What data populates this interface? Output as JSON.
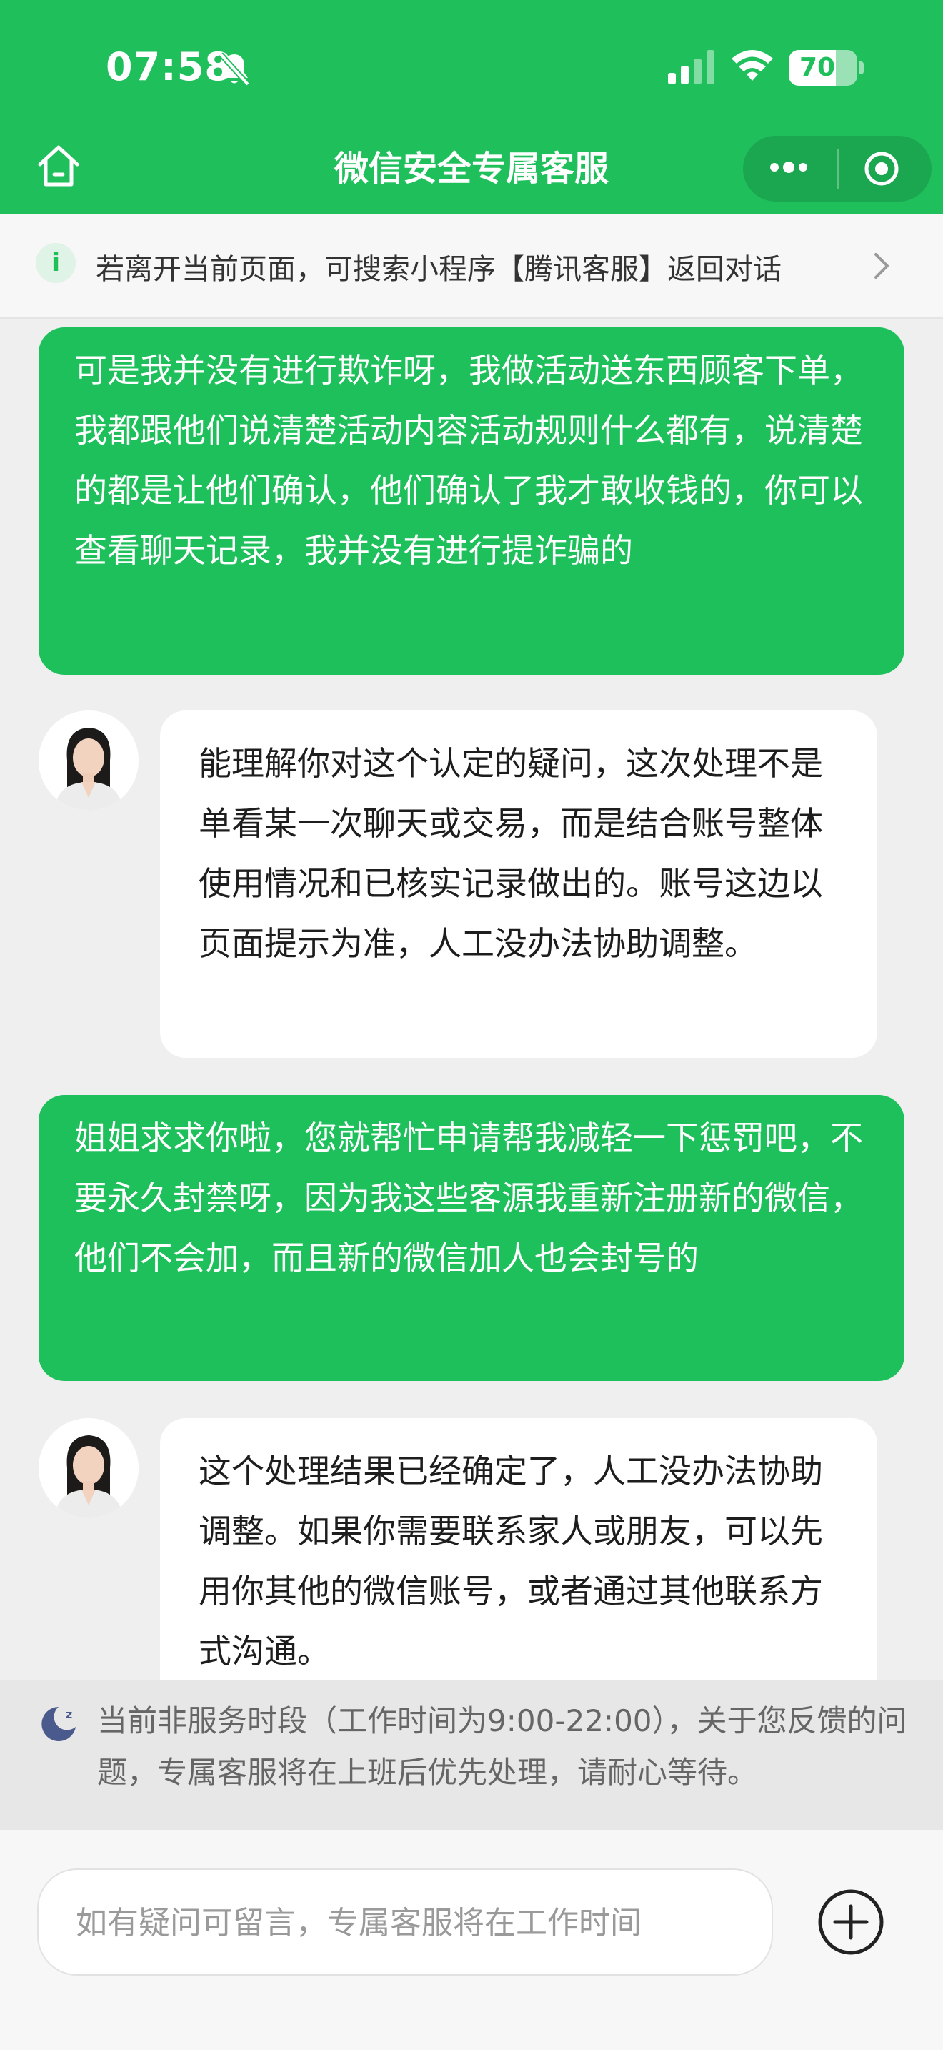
{
  "status_bar": {
    "time": "07:58",
    "battery": "70"
  },
  "nav": {
    "title": "微信安全专属客服"
  },
  "notice": {
    "text": "若离开当前页面，可搜索小程序【腾讯客服】返回对话"
  },
  "messages": [
    {
      "side": "user",
      "text": "可是我并没有进行欺诈呀，我做活动送东西顾客下单，我都跟他们说清楚活动内容活动规则什么都有，说清楚的都是让他们确认，他们确认了我才敢收钱的，你可以查看聊天记录，我并没有进行提诈骗的"
    },
    {
      "side": "agent",
      "text": "能理解你对这个认定的疑问，这次处理不是单看某一次聊天或交易，而是结合账号整体使用情况和已核实记录做出的。账号这边以页面提示为准，人工没办法协助调整。"
    },
    {
      "side": "user",
      "text": "姐姐求求你啦，您就帮忙申请帮我减轻一下惩罚吧，不要永久封禁呀，因为我这些客源我重新注册新的微信，他们不会加，而且新的微信加人也会封号的"
    },
    {
      "side": "agent",
      "text": "这个处理结果已经确定了，人工没办法协助调整。如果你需要联系家人或朋友，可以先用你其他的微信账号，或者通过其他联系方式沟通。"
    }
  ],
  "offhours": {
    "text": "当前非服务时段（工作时间为9:00-22:00），关于您反馈的问题，专属客服将在上班后优先处理，请耐心等待。"
  },
  "input": {
    "placeholder": "如有疑问可留言，专属客服将在工作时间"
  },
  "colors": {
    "brand_green": "#1fbf5c",
    "bubble_green": "#1ec05b",
    "background": "#efefef"
  }
}
